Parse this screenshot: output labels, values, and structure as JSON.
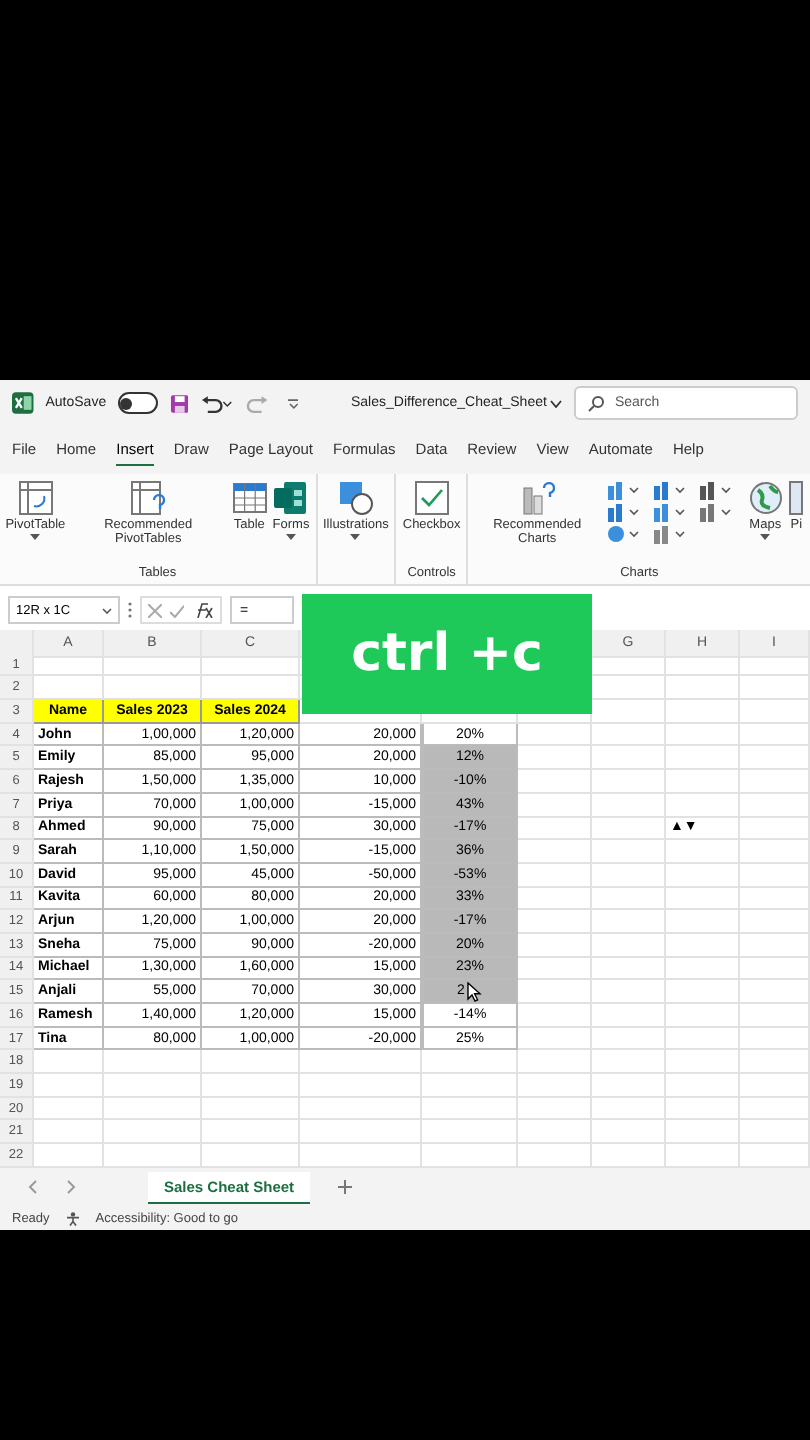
{
  "title_bar": {
    "autosave_label": "AutoSave",
    "autosave_on": false,
    "file_name": "Sales_Difference_Cheat_Sheet",
    "search_placeholder": "Search"
  },
  "menu_tabs": [
    {
      "label": "File",
      "selected": false
    },
    {
      "label": "Home",
      "selected": false
    },
    {
      "label": "Insert",
      "selected": true
    },
    {
      "label": "Draw",
      "selected": false
    },
    {
      "label": "Page Layout",
      "selected": false
    },
    {
      "label": "Formulas",
      "selected": false
    },
    {
      "label": "Data",
      "selected": false
    },
    {
      "label": "Review",
      "selected": false
    },
    {
      "label": "View",
      "selected": false
    },
    {
      "label": "Automate",
      "selected": false
    },
    {
      "label": "Help",
      "selected": false
    }
  ],
  "ribbon": [
    {
      "label": "Tables",
      "buttons": [
        {
          "kind": "pivot",
          "label": "PivotTable",
          "dropdown": true
        },
        {
          "kind": "recpivot",
          "label": "Recommended PivotTables",
          "dropdown": false
        },
        {
          "kind": "table",
          "label": "Table",
          "dropdown": false
        },
        {
          "kind": "forms",
          "label": "Forms",
          "dropdown": true
        }
      ]
    },
    {
      "buttons": [
        {
          "kind": "illustrations",
          "label": "Illustrations",
          "dropdown": true
        }
      ]
    },
    {
      "label": "Controls",
      "buttons": [
        {
          "kind": "checkbox",
          "label": "Checkbox",
          "dropdown": false
        }
      ]
    },
    {
      "label": "Charts",
      "buttons": [
        {
          "kind": "recchart",
          "label": "Recommended Charts",
          "dropdown": false
        },
        {
          "kind": "chartgrid"
        },
        {
          "kind": "maps",
          "label": "Maps",
          "dropdown": true
        },
        {
          "kind": "cut",
          "label": "Pi",
          "dropdown": false
        }
      ]
    }
  ],
  "formula_bar": {
    "name_box": "12R x 1C",
    "formula": "="
  },
  "overlay": {
    "text": "ctrl +c"
  },
  "columns": [
    {
      "label": "A"
    },
    {
      "label": "B"
    },
    {
      "label": "C"
    },
    {},
    {},
    {},
    {
      "label": "G"
    },
    {
      "label": "H"
    },
    {
      "label": "I"
    }
  ],
  "rows": [
    {
      "number": "1"
    },
    {
      "number": "2"
    },
    {
      "number": "3",
      "kind": "header",
      "name": "Name",
      "sales_2023": "Sales 2023",
      "sales_2024": "Sales 2024"
    },
    {
      "number": "4",
      "name": "John",
      "sales_2023": "1,00,000",
      "sales_2024": "1,20,000",
      "column_4": "20,000",
      "column_5": "20%",
      "selected": false
    },
    {
      "number": "5",
      "name": "Emily",
      "sales_2023": "85,000",
      "sales_2024": "95,000",
      "column_4": "20,000",
      "column_5": "12%",
      "selected": true
    },
    {
      "number": "6",
      "name": "Rajesh",
      "sales_2023": "1,50,000",
      "sales_2024": "1,35,000",
      "column_4": "10,000",
      "column_5": "-10%",
      "selected": true
    },
    {
      "number": "7",
      "name": "Priya",
      "sales_2023": "70,000",
      "sales_2024": "1,00,000",
      "column_4": "-15,000",
      "column_5": "43%",
      "selected": true
    },
    {
      "number": "8",
      "name": "Ahmed",
      "sales_2023": "90,000",
      "sales_2024": "75,000",
      "column_4": "30,000",
      "column_5": "-17%",
      "selected": true,
      "column_8": "▲▼"
    },
    {
      "number": "9",
      "name": "Sarah",
      "sales_2023": "1,10,000",
      "sales_2024": "1,50,000",
      "column_4": "-15,000",
      "column_5": "36%",
      "selected": true
    },
    {
      "number": "10",
      "name": "David",
      "sales_2023": "95,000",
      "sales_2024": "45,000",
      "column_4": "-50,000",
      "column_5": "-53%",
      "selected": true
    },
    {
      "number": "11",
      "name": "Kavita",
      "sales_2023": "60,000",
      "sales_2024": "80,000",
      "column_4": "20,000",
      "column_5": "33%",
      "selected": true
    },
    {
      "number": "12",
      "name": "Arjun",
      "sales_2023": "1,20,000",
      "sales_2024": "1,00,000",
      "column_4": "20,000",
      "column_5": "-17%",
      "selected": true
    },
    {
      "number": "13",
      "name": "Sneha",
      "sales_2023": "75,000",
      "sales_2024": "90,000",
      "column_4": "-20,000",
      "column_5": "20%",
      "selected": true
    },
    {
      "number": "14",
      "name": "Michael",
      "sales_2023": "1,30,000",
      "sales_2024": "1,60,000",
      "column_4": "15,000",
      "column_5": "23%",
      "selected": true
    },
    {
      "number": "15",
      "name": "Anjali",
      "sales_2023": "55,000",
      "sales_2024": "70,000",
      "column_4": "30,000",
      "column_5": "2",
      "selected": true,
      "pointer": true
    },
    {
      "number": "16",
      "name": "Ramesh",
      "sales_2023": "1,40,000",
      "sales_2024": "1,20,000",
      "column_4": "15,000",
      "column_5": "-14%",
      "selected": false
    },
    {
      "number": "17",
      "name": "Tina",
      "sales_2023": "80,000",
      "sales_2024": "1,00,000",
      "column_4": "-20,000",
      "column_5": "25%",
      "selected": false
    },
    {
      "number": "18"
    },
    {
      "number": "19"
    },
    {
      "number": "20"
    },
    {
      "number": "21"
    },
    {
      "number": "22"
    }
  ],
  "sheet_tabs": [
    {
      "label": "Sales Cheat Sheet",
      "selected": true
    }
  ],
  "status_bar": {
    "state": "Ready",
    "accessibility": "Accessibility: Good to go"
  }
}
